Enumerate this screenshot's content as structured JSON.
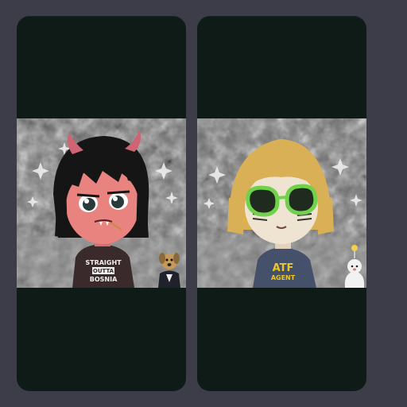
{
  "cards": [
    {
      "shirt_lines": [
        "STRAIGHT",
        "OUTTA",
        "BOSNIA"
      ],
      "colors": {
        "skin": "#e8837f",
        "hair": "#151515",
        "shirt": "#3a2a2c",
        "horns": "#cf6473"
      }
    },
    {
      "shirt_lines": [
        "ATF",
        "AGENT"
      ],
      "colors": {
        "skin": "#efe3d2",
        "hair": "#d9b055",
        "shirt": "#45516a",
        "glasses": "#6fd24a"
      }
    }
  ]
}
